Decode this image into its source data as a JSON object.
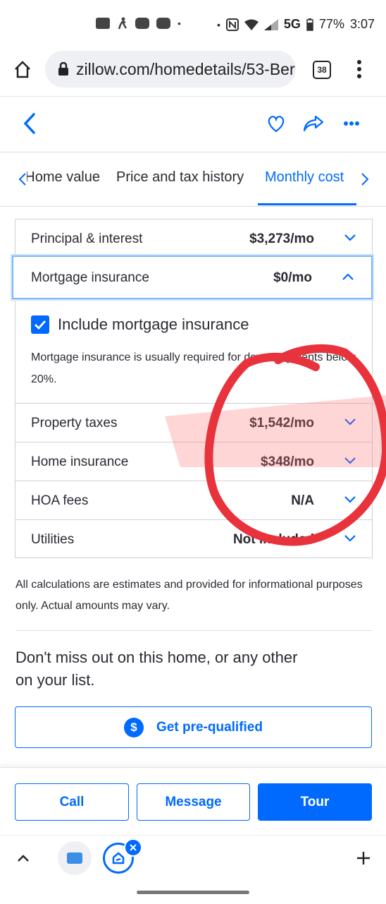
{
  "status_bar": {
    "network": "5G",
    "battery": "77%",
    "time": "3:07"
  },
  "browser": {
    "url": "zillow.com/homedetails/53-Ber",
    "tab_count": "38"
  },
  "tabs": [
    {
      "label": "Home value"
    },
    {
      "label": "Price and tax history"
    },
    {
      "label": "Monthly cost"
    }
  ],
  "costs": {
    "principal": {
      "label": "Principal & interest",
      "value": "$3,273/mo"
    },
    "mortgage_insurance": {
      "label": "Mortgage insurance",
      "value": "$0/mo"
    },
    "include_mi_label": "Include mortgage insurance",
    "mi_note": "Mortgage insurance is usually required for down payments below 20%.",
    "property_taxes": {
      "label": "Property taxes",
      "value": "$1,542/mo"
    },
    "home_insurance": {
      "label": "Home insurance",
      "value": "$348/mo"
    },
    "hoa": {
      "label": "HOA fees",
      "value": "N/A"
    },
    "utilities": {
      "label": "Utilities",
      "value": "Not included"
    }
  },
  "disclaimer": "All calculations are estimates and provided for informational purposes only. Actual amounts may vary.",
  "cta": {
    "text": "Don't miss out on this home, or any other on your list.",
    "prequalify": "Get pre-qualified",
    "dollar_icon": "$"
  },
  "actions": {
    "call": "Call",
    "message": "Message",
    "tour": "Tour"
  },
  "colors": {
    "accent": "#006aff",
    "annotation": "#e8323c"
  }
}
